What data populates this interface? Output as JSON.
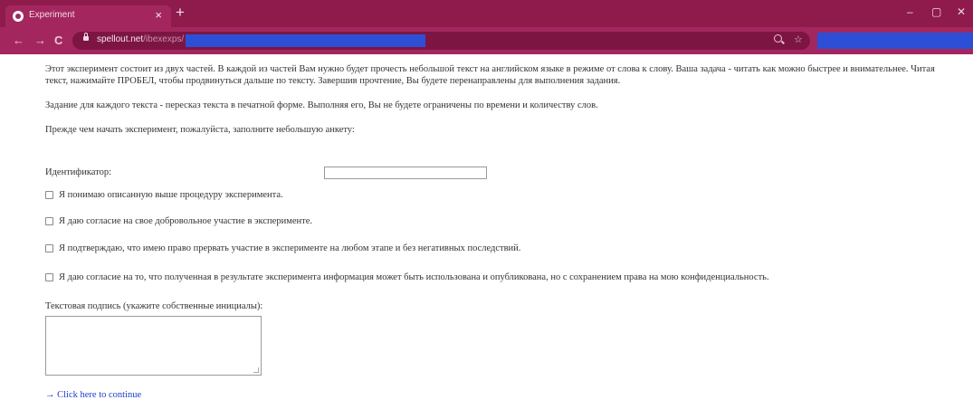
{
  "browser": {
    "tab_title": "Experiment",
    "tab_close": "×",
    "new_tab": "+",
    "minimize": "–",
    "maximize": "▢",
    "close": "✕",
    "back": "←",
    "forward": "→",
    "reload": "C",
    "url_host": "spellout.net",
    "url_path": "/ibexexps/",
    "star": "☆",
    "colors": {
      "tabbar": "#8e1b4b",
      "toolbar": "#a3275e",
      "mask": "#2d4fd6"
    }
  },
  "intro": {
    "p1": "Этот эксперимент состоит из двух частей. В каждой из частей Вам нужно будет прочесть небольшой текст на английском языке в режиме от слова к слову. Ваша задача - читать как можно быстрее и внимательнее. Читая текст, нажимайте ПРОБЕЛ, чтобы продвинуться дальше по тексту. Завершив прочтение, Вы будете перенаправлены для выполнения задания.",
    "p2": "Задание для каждого текста - пересказ текста в печатной форме. Выполняя его, Вы не будете ограничены по времени и количеству слов.",
    "p3": "Прежде чем начать эксперимент, пожалуйста, заполните небольшую анкету:"
  },
  "form": {
    "id_label": "Идентификатор:",
    "id_value": "",
    "checkboxes": [
      "Я понимаю описанную выше процедуру эксперимента.",
      "Я даю согласие на свое добровольное участие в эксперименте.",
      "Я подтверждаю, что имею право прервать участие в эксперименте на любом этапе и без негативных последствий.",
      "Я даю согласие на то, что полученная в результате эксперимента информация может быть использована и опубликована, но с сохранением права на мою конфиденциальность."
    ],
    "signature_label": "Текстовая подпись (укажите собственные инициалы):",
    "signature_value": "",
    "continue_link": "→ Click here to continue"
  }
}
